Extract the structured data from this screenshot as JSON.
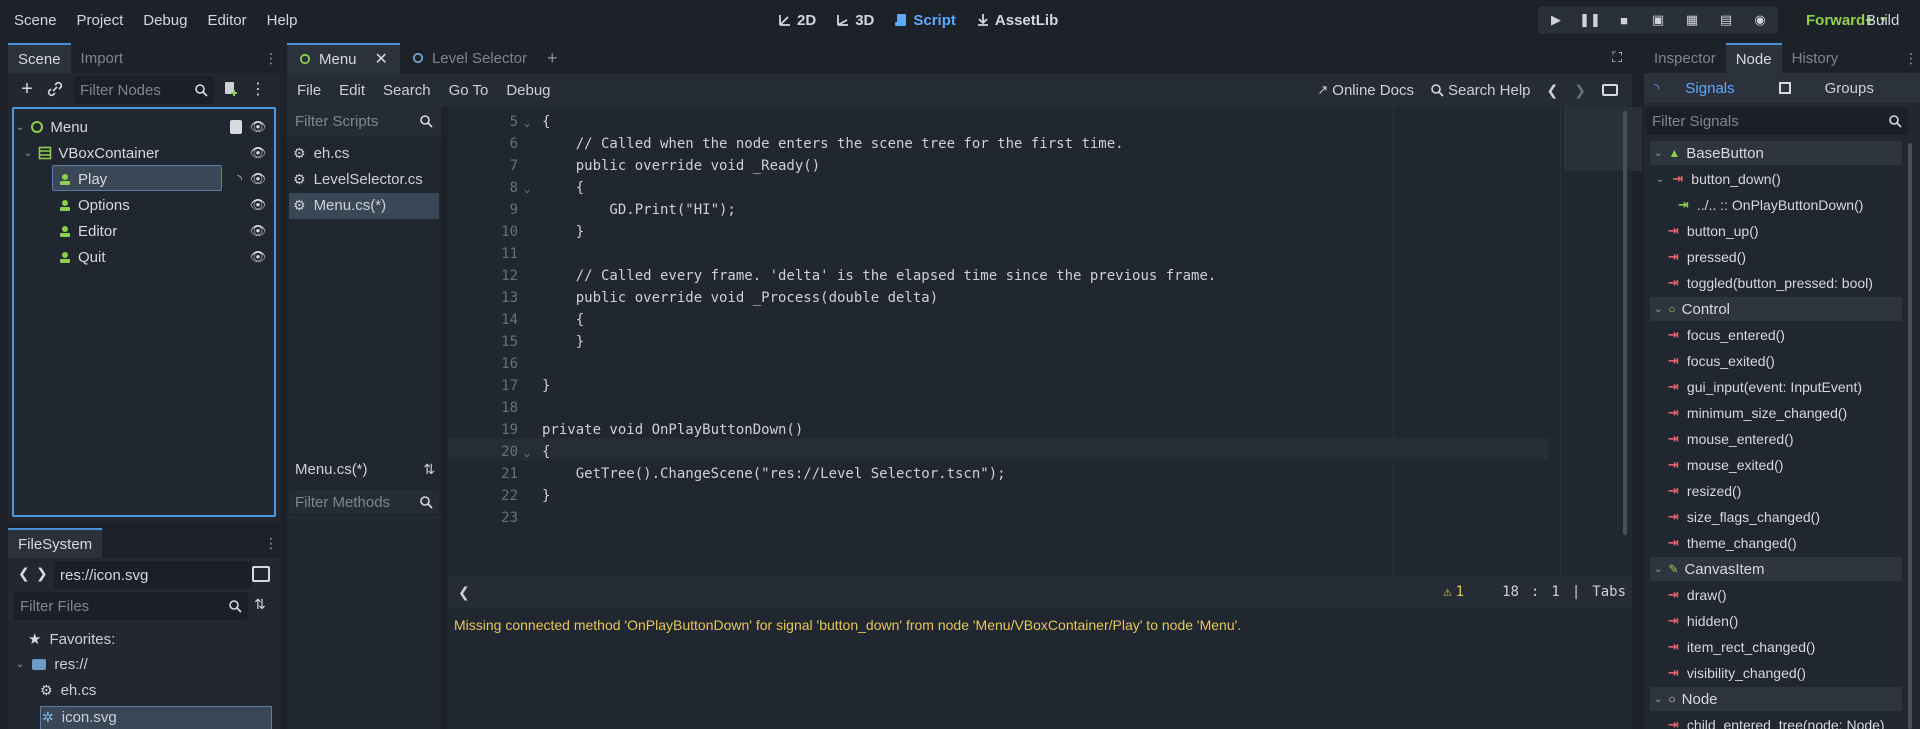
{
  "menubar": {
    "items": [
      "Scene",
      "Project",
      "Debug",
      "Editor",
      "Help"
    ]
  },
  "workspaces": [
    {
      "label": "2D",
      "icon": "2d-icon",
      "active": false
    },
    {
      "label": "3D",
      "icon": "3d-icon",
      "active": false
    },
    {
      "label": "Script",
      "icon": "script-icon",
      "active": true
    },
    {
      "label": "AssetLib",
      "icon": "assetlib-icon",
      "active": false
    }
  ],
  "renderer": {
    "label": "Forward+"
  },
  "build": {
    "label": "Build"
  },
  "scene_dock": {
    "tabs": [
      "Scene",
      "Import"
    ],
    "filter_placeholder": "Filter Nodes",
    "tree": [
      {
        "label": "Menu",
        "icon": "control-node-icon",
        "indent": 0,
        "selected": false
      },
      {
        "label": "VBoxContainer",
        "icon": "vboxcontainer-icon",
        "indent": 1,
        "selected": false
      },
      {
        "label": "Play",
        "icon": "button-icon",
        "indent": 2,
        "selected": true
      },
      {
        "label": "Options",
        "icon": "button-icon",
        "indent": 2,
        "selected": false
      },
      {
        "label": "Editor",
        "icon": "button-icon",
        "indent": 2,
        "selected": false
      },
      {
        "label": "Quit",
        "icon": "button-icon",
        "indent": 2,
        "selected": false
      }
    ]
  },
  "filesystem": {
    "tab": "FileSystem",
    "path": "res://icon.svg",
    "filter_placeholder": "Filter Files",
    "favorites_label": "Favorites:",
    "items": [
      {
        "label": "res://",
        "icon": "folder-icon"
      },
      {
        "label": "eh.cs",
        "icon": "cs-file-icon"
      },
      {
        "label": "icon.svg",
        "icon": "svg-file-icon"
      }
    ]
  },
  "script_editor": {
    "tabs": [
      {
        "label": "Menu",
        "active": true
      },
      {
        "label": "Level Selector",
        "active": false
      }
    ],
    "menu": [
      "File",
      "Edit",
      "Search",
      "Go To",
      "Debug"
    ],
    "online_docs": "Online Docs",
    "search_help": "Search Help",
    "filter_scripts_placeholder": "Filter Scripts",
    "scripts": [
      {
        "label": "eh.cs",
        "selected": false
      },
      {
        "label": "LevelSelector.cs",
        "selected": false
      },
      {
        "label": "Menu.cs(*)",
        "selected": true
      }
    ],
    "current_script": "Menu.cs(*)",
    "filter_methods_placeholder": "Filter Methods",
    "code_lines": [
      {
        "n": "5",
        "fold": true,
        "text": "{"
      },
      {
        "n": "6",
        "fold": false,
        "text": "    // Called when the node enters the scene tree for the first time."
      },
      {
        "n": "7",
        "fold": false,
        "text": "    public override void _Ready()"
      },
      {
        "n": "8",
        "fold": true,
        "text": "    {"
      },
      {
        "n": "9",
        "fold": false,
        "text": "        GD.Print(\"HI\");"
      },
      {
        "n": "10",
        "fold": false,
        "text": "    }"
      },
      {
        "n": "11",
        "fold": false,
        "text": ""
      },
      {
        "n": "12",
        "fold": false,
        "text": "    // Called every frame. 'delta' is the elapsed time since the previous frame."
      },
      {
        "n": "13",
        "fold": false,
        "text": "    public override void _Process(double delta)"
      },
      {
        "n": "14",
        "fold": false,
        "text": "    {"
      },
      {
        "n": "15",
        "fold": false,
        "text": "    }"
      },
      {
        "n": "16",
        "fold": false,
        "text": ""
      },
      {
        "n": "17",
        "fold": false,
        "text": "}"
      },
      {
        "n": "18",
        "fold": false,
        "text": ""
      },
      {
        "n": "19",
        "fold": false,
        "text": "private void OnPlayButtonDown()"
      },
      {
        "n": "20",
        "fold": true,
        "text": "{"
      },
      {
        "n": "21",
        "fold": false,
        "text": "    GetTree().ChangeScene(\"res://Level Selector.tscn\");"
      },
      {
        "n": "22",
        "fold": false,
        "text": "}"
      },
      {
        "n": "23",
        "fold": false,
        "text": ""
      }
    ],
    "status": {
      "warnings": "1",
      "line": "18",
      "col": "1",
      "indent": "Tabs"
    },
    "output_message": "Missing connected method 'OnPlayButtonDown' for signal 'button_down' from node 'Menu/VBoxContainer/Play' to node 'Menu'."
  },
  "inspector": {
    "tabs": [
      "Inspector",
      "Node",
      "History"
    ],
    "subtabs": [
      "Signals",
      "Groups"
    ],
    "filter_placeholder": "Filter Signals",
    "groups": [
      {
        "name": "BaseButton",
        "icon": "basebutton-icon",
        "signals": [
          "button_down()",
          "../.. :: OnPlayButtonDown()",
          "button_up()",
          "pressed()",
          "toggled(button_pressed: bool)"
        ]
      },
      {
        "name": "Control",
        "icon": "control-icon",
        "signals": [
          "focus_entered()",
          "focus_exited()",
          "gui_input(event: InputEvent)",
          "minimum_size_changed()",
          "mouse_entered()",
          "mouse_exited()",
          "resized()",
          "size_flags_changed()",
          "theme_changed()"
        ]
      },
      {
        "name": "CanvasItem",
        "icon": "canvasitem-icon",
        "signals": [
          "draw()",
          "hidden()",
          "item_rect_changed()",
          "visibility_changed()"
        ]
      },
      {
        "name": "Node",
        "icon": "node-icon",
        "signals": [
          "child_entered_tree(node: Node)"
        ]
      }
    ]
  },
  "colors": {
    "accent": "#4b97e0",
    "renderer": "#8fcf4e",
    "warning": "#e7c65a",
    "signal": "#e5636b",
    "connection": "#8fcf4e"
  }
}
